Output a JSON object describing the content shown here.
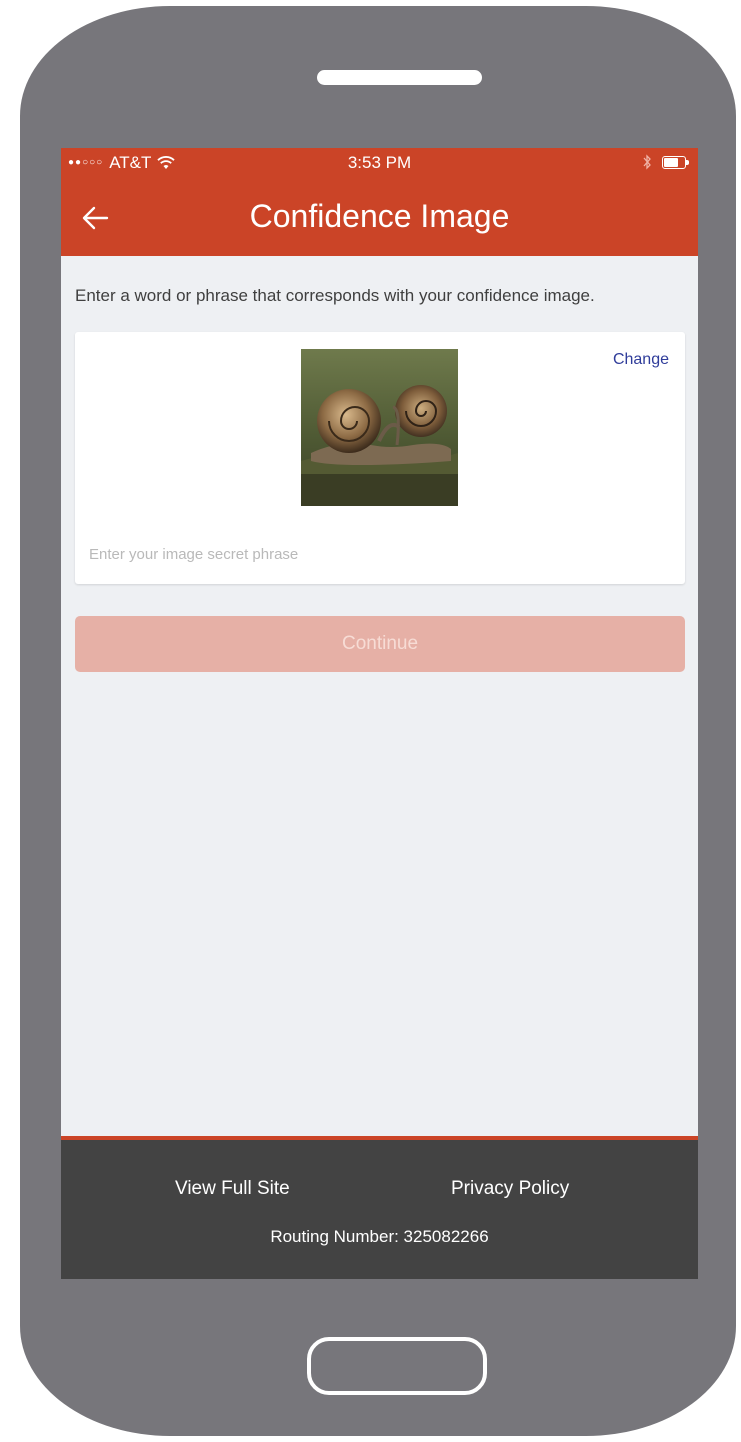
{
  "status_bar": {
    "signal": "●●○○○",
    "carrier": "AT&T",
    "time": "3:53 PM"
  },
  "header": {
    "title": "Confidence Image",
    "back_icon": "arrow-left-icon"
  },
  "instruction": "Enter a word or phrase that corresponds with your confidence image.",
  "confidence_card": {
    "image": "snails-photo",
    "change_label": "Change",
    "phrase_placeholder": "Enter your image secret phrase",
    "phrase_value": ""
  },
  "continue_label": "Continue",
  "footer": {
    "view_full_site": "View Full Site",
    "privacy_policy": "Privacy Policy",
    "routing_number": "Routing Number: 325082266"
  },
  "colors": {
    "brand": "#cb4427",
    "continue_disabled": "#e6b0a6",
    "link": "#2f3c9a",
    "footer_bg": "#434343",
    "phone_body": "#77767b"
  }
}
